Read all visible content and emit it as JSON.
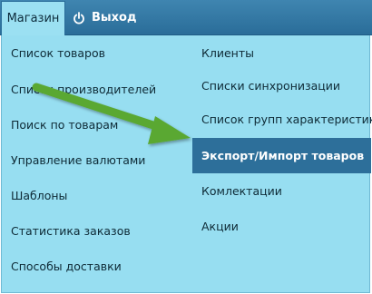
{
  "topbar": {
    "shop_tab_label": "Магазин",
    "exit_label": "Выход"
  },
  "menu": {
    "left_items": [
      {
        "label": "Список товаров"
      },
      {
        "label": "Список производителей"
      },
      {
        "label": "Поиск по товарам"
      },
      {
        "label": "Управление валютами"
      },
      {
        "label": "Шаблоны"
      },
      {
        "label": "Статистика заказов"
      },
      {
        "label": "Способы доставки"
      }
    ],
    "right_items": [
      {
        "label": "Клиенты"
      },
      {
        "label": "Списки синхронизации"
      },
      {
        "label": "Список групп характеристик"
      },
      {
        "label": "Экспорт/Импорт товаров",
        "active": true
      },
      {
        "label": "Комлектации"
      },
      {
        "label": "Акции"
      }
    ]
  },
  "colors": {
    "panel_bg": "#97def1",
    "topbar_bg": "#2a6d99",
    "active_bg": "#2d6f9a",
    "arrow": "#5aa832"
  }
}
